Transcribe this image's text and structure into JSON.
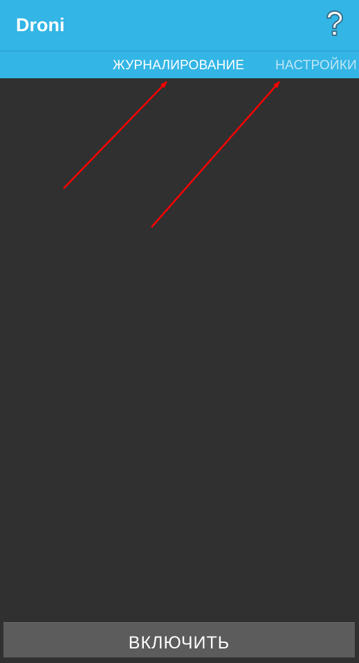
{
  "app": {
    "title": "Droni"
  },
  "toolbar": {
    "help_icon": "question-mark-icon"
  },
  "tabs": [
    {
      "label": "ЖУРНАЛИРОВАНИЕ",
      "selected": true
    },
    {
      "label": "НАСТРОЙКИ",
      "selected": false
    }
  ],
  "actions": {
    "enable_label": "ВКЛЮЧИТЬ"
  },
  "colors": {
    "primary": "#33b5e5",
    "background": "#303030",
    "button": "#5c5c5c",
    "annotation_arrow": "#ff0000",
    "help_icon_fill": "#ffffff",
    "help_icon_outline": "#3a6f8a"
  }
}
